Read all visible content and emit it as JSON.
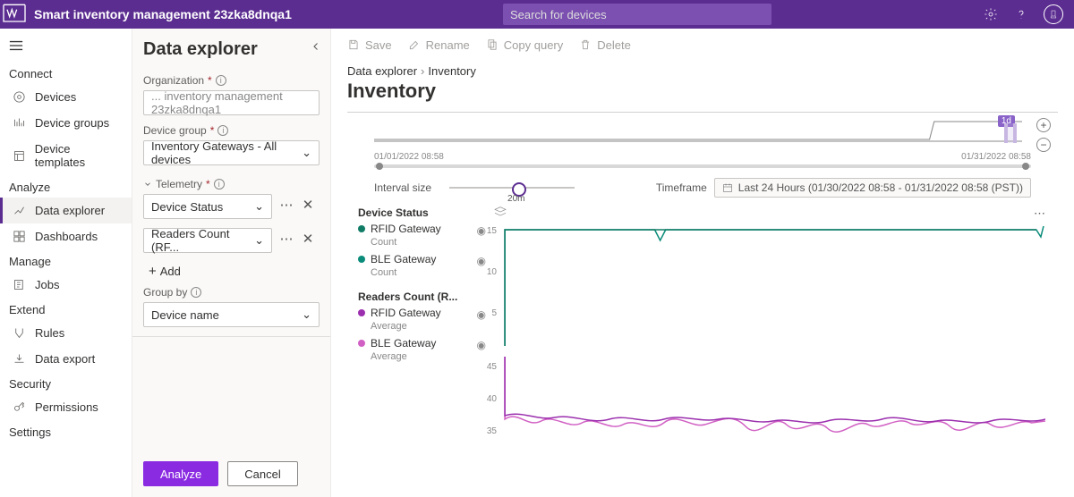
{
  "topbar": {
    "title": "Smart inventory management 23zka8dnqa1",
    "search_placeholder": "Search for devices"
  },
  "nav": {
    "sections": {
      "connect": "Connect",
      "analyze": "Analyze",
      "manage": "Manage",
      "extend": "Extend",
      "security": "Security",
      "settings": "Settings"
    },
    "items": {
      "devices": "Devices",
      "device_groups": "Device groups",
      "device_templates": "Device templates",
      "data_explorer": "Data explorer",
      "dashboards": "Dashboards",
      "jobs": "Jobs",
      "rules": "Rules",
      "data_export": "Data export",
      "permissions": "Permissions"
    }
  },
  "panel": {
    "title": "Data explorer",
    "org_label": "Organization",
    "org_value": "... inventory management 23zka8dnqa1",
    "group_label": "Device group",
    "group_value": "Inventory Gateways - All devices",
    "telemetry_label": "Telemetry",
    "telemetry_1": "Device Status",
    "telemetry_2": "Readers Count (RF...",
    "add_label": "Add",
    "groupby_label": "Group by",
    "groupby_value": "Device name",
    "analyze_btn": "Analyze",
    "cancel_btn": "Cancel"
  },
  "cmdbar": {
    "save": "Save",
    "rename": "Rename",
    "copy": "Copy query",
    "delete": "Delete"
  },
  "bc": {
    "root": "Data explorer",
    "leaf": "Inventory"
  },
  "page_title": "Inventory",
  "timeline": {
    "start": "01/01/2022 08:58",
    "end": "01/31/2022 08:58",
    "badge": "1d"
  },
  "interval": {
    "label": "Interval size",
    "value": "20m"
  },
  "timeframe": {
    "label": "Timeframe",
    "value": "Last 24 Hours (01/30/2022 08:58 - 01/31/2022 08:58 (PST))"
  },
  "legend": {
    "ds_title": "Device Status",
    "ds_items": [
      {
        "name": "RFID Gateway",
        "agg": "Count",
        "color": "#107c66"
      },
      {
        "name": "BLE Gateway",
        "agg": "Count",
        "color": "#0b8c7a"
      }
    ],
    "rc_title": "Readers Count (R...",
    "rc_items": [
      {
        "name": "RFID Gateway",
        "agg": "Average",
        "color": "#9b2fae"
      },
      {
        "name": "BLE Gateway",
        "agg": "Average",
        "color": "#d160c4"
      }
    ]
  },
  "chart_data": {
    "type": "line",
    "panels": [
      {
        "title": "Device Status",
        "ylabel": "Count",
        "ylim": [
          0,
          16
        ],
        "yticks": [
          5,
          10,
          15
        ],
        "x_range": [
          "2022-01-30T08:58",
          "2022-01-31T08:58"
        ],
        "series": [
          {
            "name": "RFID Gateway",
            "color": "#107c66",
            "shape": "flat",
            "value": 15,
            "dip_at": 0.28,
            "dip_to": 13
          },
          {
            "name": "BLE Gateway",
            "color": "#0b8c7a",
            "shape": "flat",
            "value": 15,
            "tail_drop": true
          }
        ]
      },
      {
        "title": "Readers Count",
        "ylabel": "Average",
        "ylim": [
          30,
          48
        ],
        "yticks": [
          35,
          40,
          45
        ],
        "x_range": [
          "2022-01-30T08:58",
          "2022-01-31T08:58"
        ],
        "series": [
          {
            "name": "RFID Gateway",
            "color": "#9b2fae",
            "shape": "wavy",
            "mean": 37,
            "amplitude": 3
          },
          {
            "name": "BLE Gateway",
            "color": "#d160c4",
            "shape": "wavy",
            "mean": 36,
            "amplitude": 4
          }
        ]
      }
    ]
  }
}
